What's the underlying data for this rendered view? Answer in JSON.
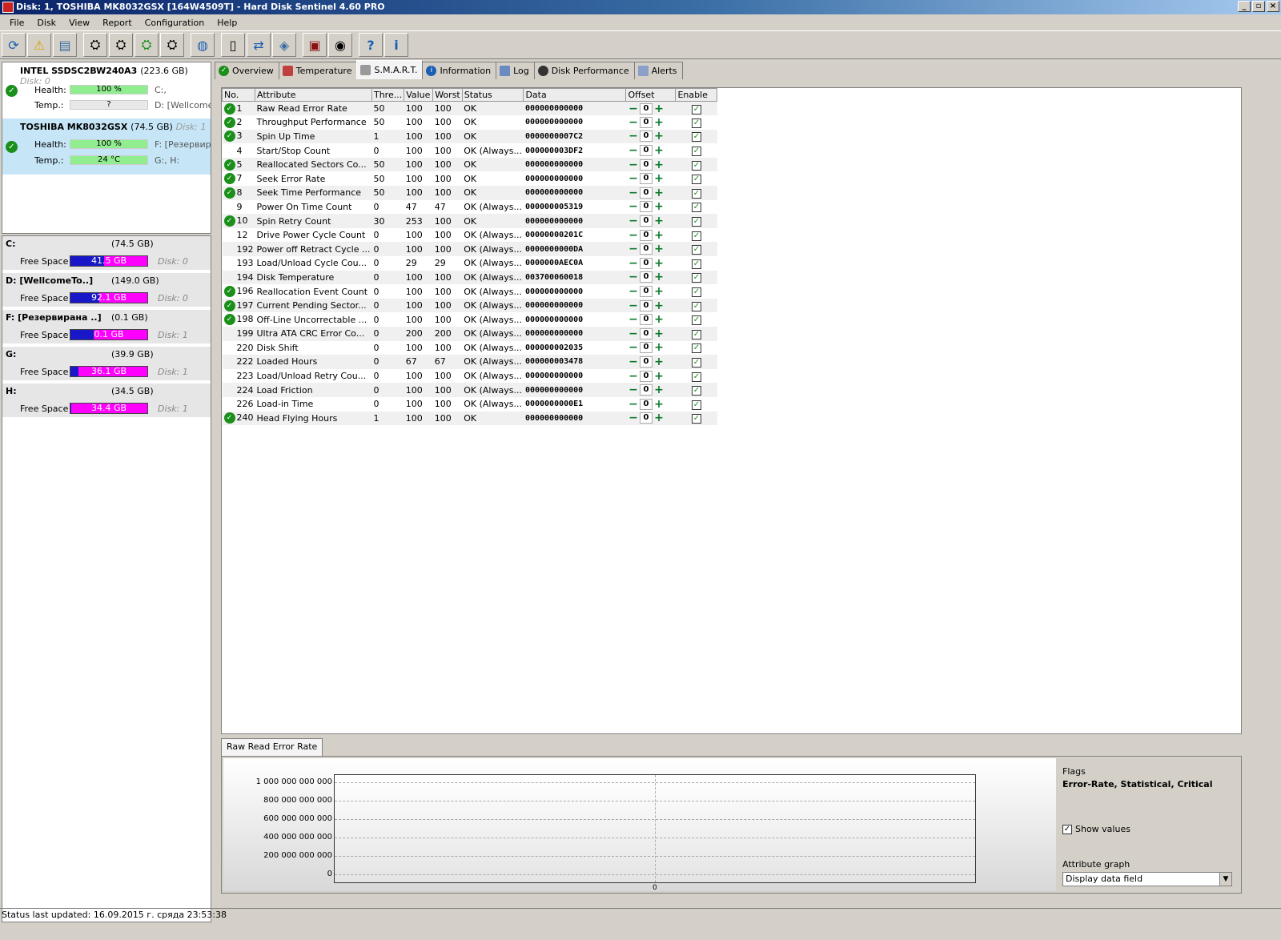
{
  "window": {
    "title": "Disk: 1, TOSHIBA MK8032GSX [164W4509T]  -  Hard Disk Sentinel 4.60 PRO"
  },
  "menu": [
    "File",
    "Disk",
    "View",
    "Report",
    "Configuration",
    "Help"
  ],
  "disks": [
    {
      "name": "INTEL SSDSC2BW240A3",
      "size": "(223.6 GB)",
      "disk_no": "Disk: 0",
      "health_label": "Health:",
      "health": "100 %",
      "temp_label": "Temp.:",
      "temp": "?",
      "letters1": "C:,",
      "letters2": "D: [Wellcome"
    },
    {
      "name": "TOSHIBA MK8032GSX",
      "size": "(74.5 GB)",
      "disk_no": "Disk: 1",
      "health_label": "Health:",
      "health": "100 %",
      "temp_label": "Temp.:",
      "temp": "24 °C",
      "letters1": "F: [Резервира",
      "letters2": "G:, H:"
    }
  ],
  "partitions": [
    {
      "name": "C:",
      "size": "(74.5 GB)",
      "free_label": "Free Space",
      "free": "41.5 GB",
      "disk": "Disk: 0",
      "used_fraction": 0.44
    },
    {
      "name": "D: [WellcomeTo..]",
      "size": "(149.0 GB)",
      "free_label": "Free Space",
      "free": "92.1 GB",
      "disk": "Disk: 0",
      "used_fraction": 0.38
    },
    {
      "name": "F: [Резервирана ..]",
      "size": "(0.1 GB)",
      "free_label": "Free Space",
      "free": "0.1 GB",
      "disk": "Disk: 1",
      "used_fraction": 0.3
    },
    {
      "name": "G:",
      "size": "(39.9 GB)",
      "free_label": "Free Space",
      "free": "36.1 GB",
      "disk": "Disk: 1",
      "used_fraction": 0.1
    },
    {
      "name": "H:",
      "size": "(34.5 GB)",
      "free_label": "Free Space",
      "free": "34.4 GB",
      "disk": "Disk: 1",
      "used_fraction": 0.01
    }
  ],
  "tabs": [
    "Overview",
    "Temperature",
    "S.M.A.R.T.",
    "Information",
    "Log",
    "Disk Performance",
    "Alerts"
  ],
  "smart_headers": [
    "No.",
    "Attribute",
    "Thre...",
    "Value",
    "Worst",
    "Status",
    "Data",
    "Offset",
    "Enable"
  ],
  "smart_rows": [
    [
      "1",
      "Raw Read Error Rate",
      "50",
      "100",
      "100",
      "OK",
      "000000000000",
      true
    ],
    [
      "2",
      "Throughput Performance",
      "50",
      "100",
      "100",
      "OK",
      "000000000000",
      true
    ],
    [
      "3",
      "Spin Up Time",
      "1",
      "100",
      "100",
      "OK",
      "0000000007C2",
      true
    ],
    [
      "4",
      "Start/Stop Count",
      "0",
      "100",
      "100",
      "OK (Always...",
      "000000003DF2",
      false
    ],
    [
      "5",
      "Reallocated Sectors Co...",
      "50",
      "100",
      "100",
      "OK",
      "000000000000",
      true
    ],
    [
      "7",
      "Seek Error Rate",
      "50",
      "100",
      "100",
      "OK",
      "000000000000",
      true
    ],
    [
      "8",
      "Seek Time Performance",
      "50",
      "100",
      "100",
      "OK",
      "000000000000",
      true
    ],
    [
      "9",
      "Power On Time Count",
      "0",
      "47",
      "47",
      "OK (Always...",
      "000000005319",
      false
    ],
    [
      "10",
      "Spin Retry Count",
      "30",
      "253",
      "100",
      "OK",
      "000000000000",
      true
    ],
    [
      "12",
      "Drive Power Cycle Count",
      "0",
      "100",
      "100",
      "OK (Always...",
      "00000000201C",
      false
    ],
    [
      "192",
      "Power off Retract Cycle ...",
      "0",
      "100",
      "100",
      "OK (Always...",
      "0000000000DA",
      false
    ],
    [
      "193",
      "Load/Unload Cycle Cou...",
      "0",
      "29",
      "29",
      "OK (Always...",
      "0000000AEC0A",
      false
    ],
    [
      "194",
      "Disk Temperature",
      "0",
      "100",
      "100",
      "OK (Always...",
      "003700060018",
      false
    ],
    [
      "196",
      "Reallocation Event Count",
      "0",
      "100",
      "100",
      "OK (Always...",
      "000000000000",
      true
    ],
    [
      "197",
      "Current Pending Sector...",
      "0",
      "100",
      "100",
      "OK (Always...",
      "000000000000",
      true
    ],
    [
      "198",
      "Off-Line Uncorrectable ...",
      "0",
      "100",
      "100",
      "OK (Always...",
      "000000000000",
      true
    ],
    [
      "199",
      "Ultra ATA CRC Error Co...",
      "0",
      "200",
      "200",
      "OK (Always...",
      "000000000000",
      false
    ],
    [
      "220",
      "Disk Shift",
      "0",
      "100",
      "100",
      "OK (Always...",
      "000000002035",
      false
    ],
    [
      "222",
      "Loaded Hours",
      "0",
      "67",
      "67",
      "OK (Always...",
      "000000003478",
      false
    ],
    [
      "223",
      "Load/Unload Retry Cou...",
      "0",
      "100",
      "100",
      "OK (Always...",
      "000000000000",
      false
    ],
    [
      "224",
      "Load Friction",
      "0",
      "100",
      "100",
      "OK (Always...",
      "000000000000",
      false
    ],
    [
      "226",
      "Load-in Time",
      "0",
      "100",
      "100",
      "OK (Always...",
      "0000000000E1",
      false
    ],
    [
      "240",
      "Head Flying Hours",
      "1",
      "100",
      "100",
      "OK",
      "000000000000",
      true
    ]
  ],
  "offset_value": "0",
  "graph": {
    "tab_label": "Raw Read Error Rate",
    "y_ticks": [
      "1 000 000 000 000",
      "800 000 000 000",
      "600 000 000 000",
      "400 000 000 000",
      "200 000 000 000",
      "0"
    ],
    "x_tick": "0",
    "flags_label": "Flags",
    "flags_value": "Error-Rate, Statistical, Critical",
    "show_values_label": "Show values",
    "show_values_checked": true,
    "attr_graph_label": "Attribute graph",
    "attr_graph_value": "Display data field"
  },
  "status": "Status last updated: 16.09.2015 г. сряда 23:53:38"
}
